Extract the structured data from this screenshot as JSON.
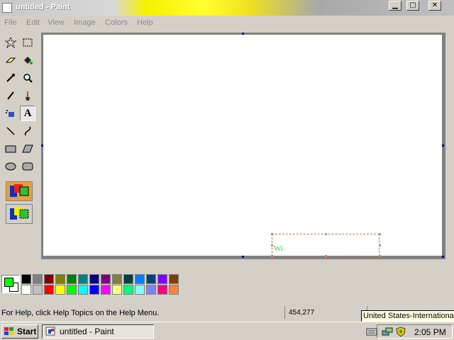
{
  "window": {
    "title": "untitled - Paint"
  },
  "menu": [
    "File",
    "Edit",
    "View",
    "Image",
    "Colors",
    "Help"
  ],
  "tools": [
    {
      "name": "free-form-select-tool",
      "glyph": "⟡"
    },
    {
      "name": "select-tool",
      "glyph": "⬚"
    },
    {
      "name": "eraser-tool",
      "glyph": "▰"
    },
    {
      "name": "fill-tool",
      "glyph": "◆"
    },
    {
      "name": "pick-color-tool",
      "glyph": "✎"
    },
    {
      "name": "magnifier-tool",
      "glyph": "⚲"
    },
    {
      "name": "pencil-tool",
      "glyph": "✏"
    },
    {
      "name": "brush-tool",
      "glyph": "♜"
    },
    {
      "name": "airbrush-tool",
      "glyph": "✦"
    },
    {
      "name": "text-tool",
      "glyph": "A"
    },
    {
      "name": "line-tool",
      "glyph": "╲"
    },
    {
      "name": "curve-tool",
      "glyph": "∫"
    },
    {
      "name": "rectangle-tool",
      "glyph": "▭"
    },
    {
      "name": "polygon-tool",
      "glyph": "⏢"
    },
    {
      "name": "ellipse-tool",
      "glyph": "⬭"
    },
    {
      "name": "rounded-rectangle-tool",
      "glyph": "▢"
    }
  ],
  "canvas": {
    "text_content": "Wi",
    "text_color": "#44cc44"
  },
  "colors": {
    "foreground": "#00ff00",
    "background": "#ffffff",
    "palette_top": [
      "#000000",
      "#808080",
      "#800000",
      "#808000",
      "#008000",
      "#008080",
      "#000080",
      "#800080",
      "#808040",
      "#004040",
      "#0080ff",
      "#004080",
      "#8000ff",
      "#804000"
    ],
    "palette_bottom": [
      "#ffffff",
      "#c0c0c0",
      "#ff0000",
      "#ffff00",
      "#00ff00",
      "#00ffff",
      "#0000ff",
      "#ff00ff",
      "#ffff80",
      "#00ff80",
      "#80ffff",
      "#8080ff",
      "#ff0080",
      "#ff8040"
    ]
  },
  "status": {
    "help_text": "For Help, click Help Topics on the Help Menu.",
    "coordinates": "454,277"
  },
  "tooltip": "United States-International",
  "taskbar": {
    "start_label": "Start",
    "task_label": "untitled - Paint",
    "clock": "2:05 PM"
  }
}
